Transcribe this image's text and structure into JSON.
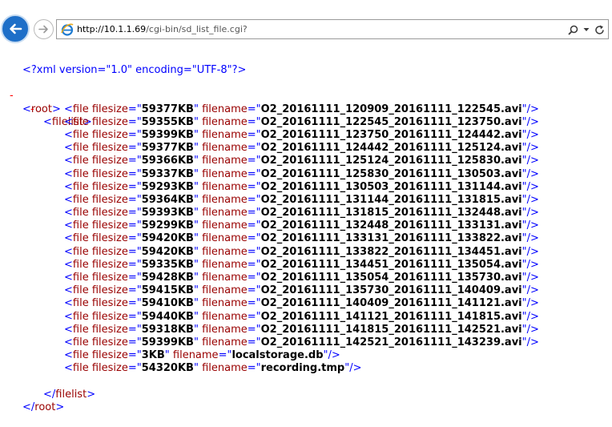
{
  "browser": {
    "url_host": "http://10.1.1.69",
    "url_path": "/cgi-bin/sd_list_file.cgi?",
    "search_icon": "magnifier-icon",
    "dropdown_icon": "chevron-down-icon",
    "refresh_icon": "refresh-icon"
  },
  "xml": {
    "declaration": "<?xml version=\"1.0\" encoding=\"UTF-8\"?>",
    "collapse_symbol": "-",
    "root_open": "<root>",
    "filelist_open": "<filelist>",
    "filelist_close": "</filelist>",
    "root_close": "</root>",
    "file_tag_start": "<file ",
    "file_tag_end": "/>",
    "attr_filesize": "filesize",
    "attr_filename": "filename",
    "files": [
      {
        "filesize": "59377KB",
        "filename": "O2_20161111_120909_20161111_122545.avi"
      },
      {
        "filesize": "59355KB",
        "filename": "O2_20161111_122545_20161111_123750.avi"
      },
      {
        "filesize": "59399KB",
        "filename": "O2_20161111_123750_20161111_124442.avi"
      },
      {
        "filesize": "59377KB",
        "filename": "O2_20161111_124442_20161111_125124.avi"
      },
      {
        "filesize": "59366KB",
        "filename": "O2_20161111_125124_20161111_125830.avi"
      },
      {
        "filesize": "59337KB",
        "filename": "O2_20161111_125830_20161111_130503.avi"
      },
      {
        "filesize": "59293KB",
        "filename": "O2_20161111_130503_20161111_131144.avi"
      },
      {
        "filesize": "59364KB",
        "filename": "O2_20161111_131144_20161111_131815.avi"
      },
      {
        "filesize": "59393KB",
        "filename": "O2_20161111_131815_20161111_132448.avi"
      },
      {
        "filesize": "59299KB",
        "filename": "O2_20161111_132448_20161111_133131.avi"
      },
      {
        "filesize": "59420KB",
        "filename": "O2_20161111_133131_20161111_133822.avi"
      },
      {
        "filesize": "59420KB",
        "filename": "O2_20161111_133822_20161111_134451.avi"
      },
      {
        "filesize": "59335KB",
        "filename": "O2_20161111_134451_20161111_135054.avi"
      },
      {
        "filesize": "59428KB",
        "filename": "O2_20161111_135054_20161111_135730.avi"
      },
      {
        "filesize": "59415KB",
        "filename": "O2_20161111_135730_20161111_140409.avi"
      },
      {
        "filesize": "59410KB",
        "filename": "O2_20161111_140409_20161111_141121.avi"
      },
      {
        "filesize": "59440KB",
        "filename": "O2_20161111_141121_20161111_141815.avi"
      },
      {
        "filesize": "59318KB",
        "filename": "O2_20161111_141815_20161111_142521.avi"
      },
      {
        "filesize": "59399KB",
        "filename": "O2_20161111_142521_20161111_143239.avi"
      },
      {
        "filesize": "3KB",
        "filename": "localstorage.db"
      },
      {
        "filesize": "54320KB",
        "filename": "recording.tmp"
      }
    ]
  }
}
